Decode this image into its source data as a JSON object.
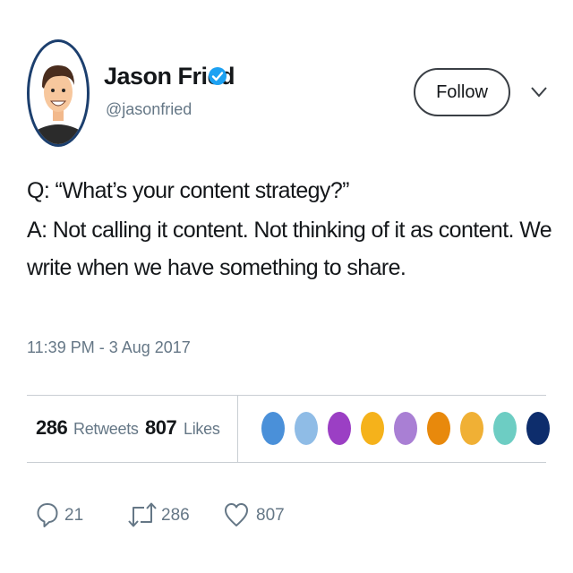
{
  "user": {
    "name": "Jason Fried",
    "handle": "@jasonfried",
    "verified_color": "#1da1f2"
  },
  "follow_button": {
    "label": "Follow"
  },
  "menu": {
    "icon": "chevron-down-icon"
  },
  "tweet": {
    "lines": [
      "Q: “What’s your content strategy?”",
      "A: Not calling it content. Not thinking of it as content. We",
      "write when we have something to share."
    ],
    "timestamp": "11:39 PM - 3 Aug 2017"
  },
  "stats": {
    "retweets": {
      "count": "286",
      "label": "Retweets"
    },
    "likes": {
      "count": "807",
      "label": "Likes"
    },
    "likers": [
      "#4a90d9",
      "#8fbce6",
      "#9b3fc4",
      "#f5b21b",
      "#a97fd4",
      "#e8890c",
      "#f0b035",
      "#6dcdc3",
      "#0d2d6c"
    ]
  },
  "actions": {
    "reply": {
      "icon": "reply-icon",
      "count": "21"
    },
    "retweet": {
      "icon": "retweet-icon",
      "count": "286"
    },
    "like": {
      "icon": "heart-icon",
      "count": "807"
    }
  }
}
